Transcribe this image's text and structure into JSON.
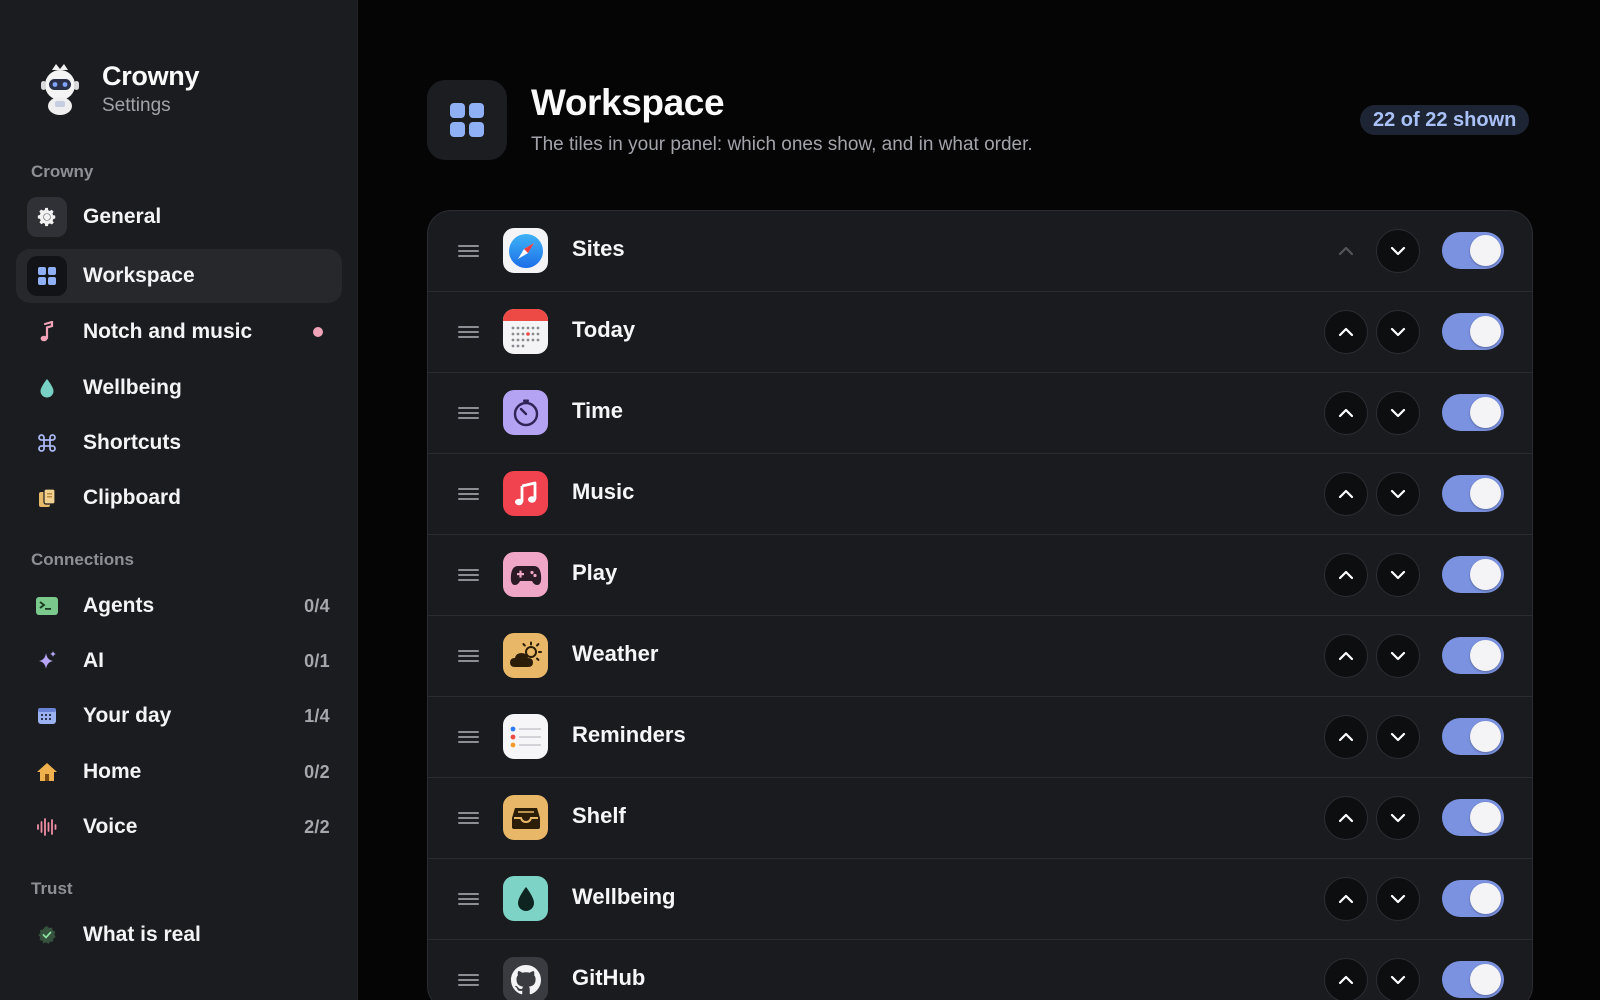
{
  "app": {
    "name": "Crowny",
    "subtitle": "Settings"
  },
  "sidebar": {
    "sections": [
      {
        "label": "Crowny",
        "items": [
          {
            "label": "General",
            "icon": "gear-icon",
            "active": false
          },
          {
            "label": "Workspace",
            "icon": "grid-icon",
            "active": true
          },
          {
            "label": "Notch and music",
            "icon": "music-note-icon",
            "active": false,
            "dot": true
          },
          {
            "label": "Wellbeing",
            "icon": "water-drop-icon",
            "active": false
          },
          {
            "label": "Shortcuts",
            "icon": "command-icon",
            "active": false
          },
          {
            "label": "Clipboard",
            "icon": "clipboard-icon",
            "active": false
          }
        ]
      },
      {
        "label": "Connections",
        "items": [
          {
            "label": "Agents",
            "icon": "terminal-icon",
            "count": "0/4"
          },
          {
            "label": "AI",
            "icon": "sparkle-icon",
            "count": "0/1"
          },
          {
            "label": "Your day",
            "icon": "calendar-icon",
            "count": "1/4"
          },
          {
            "label": "Home",
            "icon": "house-icon",
            "count": "0/2"
          },
          {
            "label": "Voice",
            "icon": "waveform-icon",
            "count": "2/2"
          }
        ]
      },
      {
        "label": "Trust",
        "items": [
          {
            "label": "What is real",
            "icon": "check-shield-icon"
          }
        ]
      }
    ]
  },
  "header": {
    "title": "Workspace",
    "subtitle": "The tiles in your panel: which ones show, and in what order.",
    "badge": "22 of 22 shown"
  },
  "tiles": [
    {
      "name": "Sites",
      "icon": "compass-icon",
      "enabled": true,
      "up_disabled": true
    },
    {
      "name": "Today",
      "icon": "calendar-icon",
      "enabled": true
    },
    {
      "name": "Time",
      "icon": "timer-icon",
      "enabled": true
    },
    {
      "name": "Music",
      "icon": "music-note-icon",
      "enabled": true
    },
    {
      "name": "Play",
      "icon": "gamepad-icon",
      "enabled": true
    },
    {
      "name": "Weather",
      "icon": "cloud-sun-icon",
      "enabled": true
    },
    {
      "name": "Reminders",
      "icon": "list-icon",
      "enabled": true
    },
    {
      "name": "Shelf",
      "icon": "tray-icon",
      "enabled": true
    },
    {
      "name": "Wellbeing",
      "icon": "water-drop-icon",
      "enabled": true
    },
    {
      "name": "GitHub",
      "icon": "github-icon",
      "enabled": true
    }
  ],
  "colors": {
    "accent": "#7b92e0",
    "badge_text": "#a9c1f6",
    "notification_dot": "#f0a3b8"
  }
}
